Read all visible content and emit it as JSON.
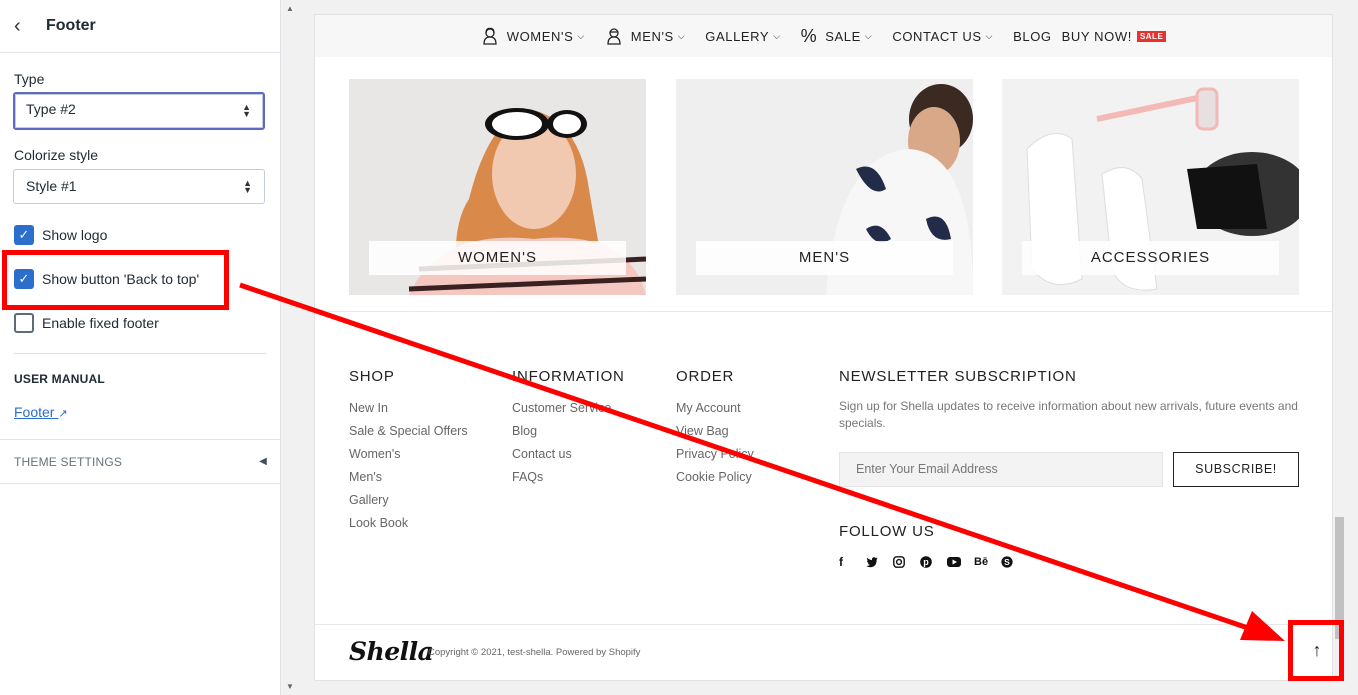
{
  "left_panel": {
    "title": "Footer",
    "type_label": "Type",
    "type_value": "Type #2",
    "colorize_label": "Colorize style",
    "colorize_value": "Style #1",
    "show_logo": "Show logo",
    "show_back_to_top": "Show button 'Back to top'",
    "enable_fixed_footer": "Enable fixed footer",
    "user_manual_title": "USER MANUAL",
    "footer_link": "Footer",
    "theme_settings": "THEME SETTINGS",
    "checkboxes": {
      "show_logo": true,
      "show_back_to_top": true,
      "enable_fixed_footer": false
    }
  },
  "preview": {
    "nav": {
      "womens": "WOMEN'S",
      "mens": "MEN'S",
      "gallery": "GALLERY",
      "sale": "SALE",
      "contact": "CONTACT US",
      "blog": "BLOG",
      "buy_now": "BUY NOW!",
      "sale_badge": "SALE"
    },
    "categories": [
      {
        "label": "WOMEN'S"
      },
      {
        "label": "MEN'S"
      },
      {
        "label": "ACCESSORIES"
      }
    ],
    "footer": {
      "shop_title": "SHOP",
      "shop_items": [
        "New In",
        "Sale & Special Offers",
        "Women's",
        "Men's",
        "Gallery",
        "Look Book"
      ],
      "info_title": "INFORMATION",
      "info_items": [
        "Customer Service",
        "Blog",
        "Contact us",
        "FAQs"
      ],
      "order_title": "ORDER",
      "order_items": [
        "My Account",
        "View Bag",
        "Privacy Policy",
        "Cookie Policy"
      ],
      "newsletter_title": "NEWSLETTER SUBSCRIPTION",
      "newsletter_text": "Sign up for Shella updates to receive information about new arrivals, future events and specials.",
      "email_placeholder": "Enter Your Email Address",
      "subscribe": "SUBSCRIBE!",
      "follow_title": "FOLLOW US",
      "socials": [
        "facebook-icon",
        "twitter-icon",
        "instagram-icon",
        "pinterest-icon",
        "youtube-icon",
        "behance-icon",
        "skype-icon"
      ],
      "logo": "Shella",
      "copyright": "Copyright © 2021, test-shella. Powered by Shopify",
      "back_to_top_icon": "↑"
    }
  },
  "colors": {
    "annotation": "#ff0000",
    "accent": "#2c6ecb",
    "sale_badge": "#e8322f"
  }
}
